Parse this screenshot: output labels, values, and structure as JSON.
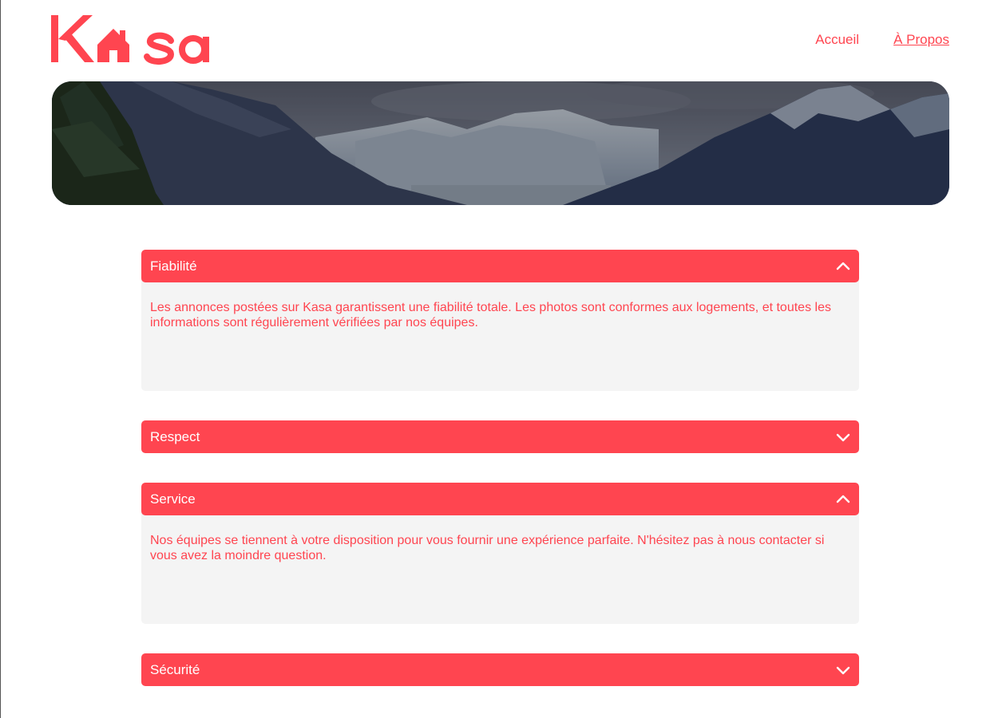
{
  "brand": {
    "name": "Kasa",
    "color": "#ff4550"
  },
  "nav": {
    "items": [
      {
        "label": "Accueil",
        "active": false
      },
      {
        "label": "À Propos",
        "active": true
      }
    ]
  },
  "banner": {
    "image": "mountain-landscape"
  },
  "collapses": [
    {
      "title": "Fiabilité",
      "open": true,
      "icon": "chevron-up-icon",
      "content": "Les annonces postées sur Kasa garantissent une fiabilité totale. Les photos sont conformes aux logements, et toutes les informations sont régulièrement vérifiées par nos équipes."
    },
    {
      "title": "Respect",
      "open": false,
      "icon": "chevron-down-icon",
      "content": ""
    },
    {
      "title": "Service",
      "open": true,
      "icon": "chevron-up-icon",
      "content": "Nos équipes se tiennent à votre disposition pour vous fournir une expérience parfaite. N'hésitez pas à nous contacter si vous avez la moindre question."
    },
    {
      "title": "Sécurité",
      "open": false,
      "icon": "chevron-down-icon",
      "content": ""
    }
  ],
  "colors": {
    "accent": "#ff4550",
    "panel": "#f4f4f4",
    "header_text": "#ffffff"
  }
}
